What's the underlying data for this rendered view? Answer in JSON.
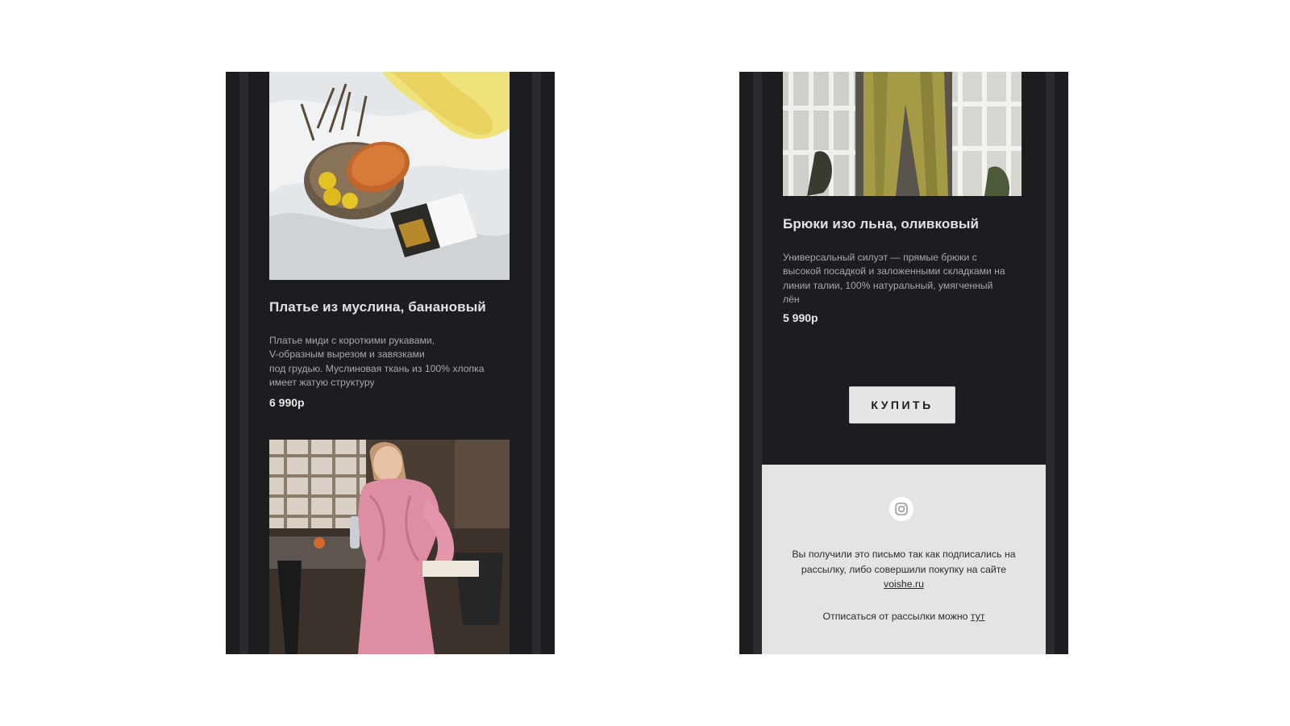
{
  "left_panel": {
    "product": {
      "title": "Платье из муслина, банановый",
      "description_lines": [
        "Платье миди с короткими рукавами,",
        "V-образным вырезом и завязками",
        "под грудью. Муслиновая ткань из 100% хлопка",
        "имеет жатую структуру"
      ],
      "price": "6 990р"
    }
  },
  "right_panel": {
    "product": {
      "title": "Брюки изо льна, оливковый",
      "description_lines": [
        "Универсальный силуэт — прямые брюки с",
        "высокой посадкой и заложенными складками на",
        "линии талии, 100% натуральный, умягченный",
        "лён"
      ],
      "price": "5 990р"
    },
    "buy_button_label": "КУПИТЬ",
    "footer": {
      "icon": "instagram-icon",
      "notice_line_1": "Вы получили это письмо так как подписались на",
      "notice_line_2": "рассылку, либо совершили покупку на сайте",
      "site_link": "voishe.ru",
      "unsubscribe_text": "Отписаться от рассылки можно",
      "unsubscribe_link": "тут"
    }
  },
  "colors": {
    "panel_bg": "#1c1d20",
    "stripe": "#2a2b2e",
    "footer_bg": "#e4e4e4",
    "button_bg": "#e6e6e6"
  }
}
